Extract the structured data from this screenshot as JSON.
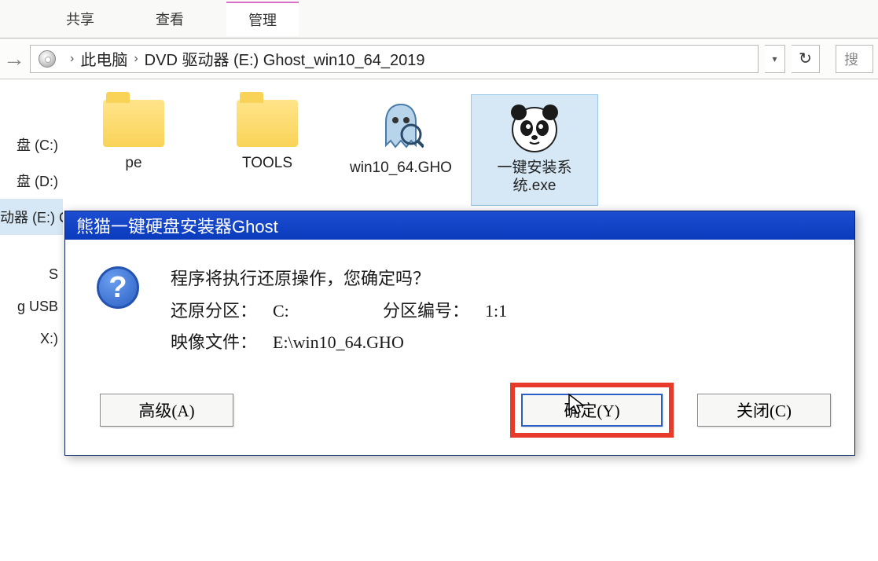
{
  "ribbon": {
    "tabs": [
      "共享",
      "查看"
    ],
    "context_tab": "管理"
  },
  "address": {
    "crumb1": "此电脑",
    "crumb2": "DVD 驱动器 (E:) Ghost_win10_64_2019",
    "search_placeholder": "搜"
  },
  "sidebar": {
    "items": [
      {
        "label": "盘 (C:)"
      },
      {
        "label": "盘 (D:)"
      },
      {
        "label": "动器 (E:) Cl"
      },
      {
        "label": "S"
      },
      {
        "label": "g USB"
      },
      {
        "label": "X:)"
      }
    ]
  },
  "files": {
    "pe": "pe",
    "tools": "TOOLS",
    "gho": "win10_64.GHO",
    "exe": "一键安装系统.exe"
  },
  "dialog": {
    "title": "熊猫一键硬盘安装器Ghost",
    "line1": "程序将执行还原操作，您确定吗？",
    "restore_label": "还原分区：",
    "restore_value": "C:",
    "partnum_label": "分区编号：",
    "partnum_value": "1:1",
    "image_label": "映像文件：",
    "image_value": "E:\\win10_64.GHO",
    "btn_advanced": "高级(A)",
    "btn_ok": "确定(Y)",
    "btn_close": "关闭(C)"
  }
}
